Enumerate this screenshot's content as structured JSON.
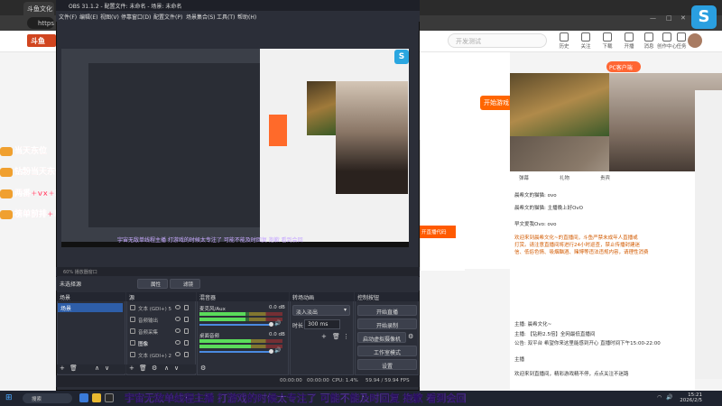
{
  "browser": {
    "tab_title": "斗鱼文化",
    "url": "https",
    "logo_text": "斗鱼",
    "search_placeholder": "开发测试",
    "nav_items": [
      "历史",
      "关注",
      "下载",
      "开播",
      "消息",
      "创作中心",
      "任务"
    ],
    "pc_client": "PC客户端",
    "start_game": "开始游戏",
    "chat_tabs": [
      "弹幕",
      "礼物",
      "贵宾"
    ],
    "chat_messages": [
      {
        "text": "晨希文的猫猫: ovo",
        "highlight": false
      },
      {
        "text": "晨希文的猫猫: 主播晚上好OvO",
        "highlight": false
      },
      {
        "text": "早文爱我Ovo: ovo",
        "highlight": false
      },
      {
        "text": "欢迎来到晨希文化~的直播间，斗鱼严禁未成年人直播或",
        "highlight": true
      },
      {
        "text": "打赏。请注意直播间将进行24小时巡查，禁止传播封建迷",
        "highlight": true
      },
      {
        "text": "信、低俗色情、吸烟酗酒、赌博等违法违规内容，请理性消费",
        "highlight": true
      },
      {
        "text": "主播: 晨希文化~",
        "highlight": false
      },
      {
        "text": "主播: 【钻粉2.5倍】全网最低直播间",
        "highlight": false
      },
      {
        "text": "公告: 双平台 希望你来这里能感到开心 直播时间下午15:00-22:00",
        "highlight": false
      },
      {
        "text": "主播",
        "highlight": false
      },
      {
        "text": "欢迎来到直播间，精彩游戏精不停，点点关注不迷路",
        "highlight": false
      }
    ],
    "dialog_button": "开直播代码"
  },
  "danmaku": [
    {
      "text": "当天东位",
      "color": "#ff3a3a"
    },
    {
      "text": "钻粉当天东位+钻粉群",
      "color": "#ff3a3a"
    },
    {
      "text": "两番+vx+东位",
      "color": "#ff4466"
    },
    {
      "text": "榜单前排+以上",
      "color": "#ff4466"
    }
  ],
  "obs": {
    "title": "OBS 31.1.2 - 配置文件: 未命名 - 场景: 未命名",
    "menu": [
      "文件(F)",
      "编辑(E)",
      "视图(V)",
      "停靠窗口(D)",
      "配置文件(P)",
      "场景集合(S)",
      "工具(T)",
      "帮助(H)"
    ],
    "preview_caption": "宇宙无敌单线程主播 打游戏的时候太专注了 可能不能及时回复 抱歉 看到会回",
    "status_top": "60%  播放器窗口",
    "no_source": "未选择源",
    "properties_btn": "属性",
    "filters_btn": "滤镜",
    "docks": {
      "scenes": "场景",
      "sources": "源",
      "mixer": "混音器",
      "transitions": "转场动画",
      "controls": "控制按钮"
    },
    "scene_name": "场景",
    "sources": [
      "文本 (GDI+) 5",
      "音频输出",
      "音频采集",
      "图像",
      "文本 (GDI+) 2"
    ],
    "mixer": [
      {
        "name": "麦克风/Aux",
        "db": "0.0 dB",
        "level": 0.55
      },
      {
        "name": "桌面音频",
        "db": "0.0 dB",
        "level": 0.62
      }
    ],
    "transition": {
      "type": "淡入淡出",
      "duration_label": "时长",
      "duration": "300 ms"
    },
    "controls": [
      "开始直播",
      "开始录制",
      "启动虚拟摄像机",
      "工作室模式",
      "设置"
    ],
    "status_bar": {
      "live_time": "00:00:00",
      "rec_time": "00:00:00",
      "cpu": "CPU: 1.4%",
      "fps": "59.94 / 59.94 FPS"
    }
  },
  "taskbar": {
    "search": "搜索",
    "time": "15:21",
    "date": "2026/2/5"
  },
  "bottom_caption": "宇宙无敌单线程主播 打游戏的时候太专注了 可能不能及时回复 抱歉 看到会回"
}
